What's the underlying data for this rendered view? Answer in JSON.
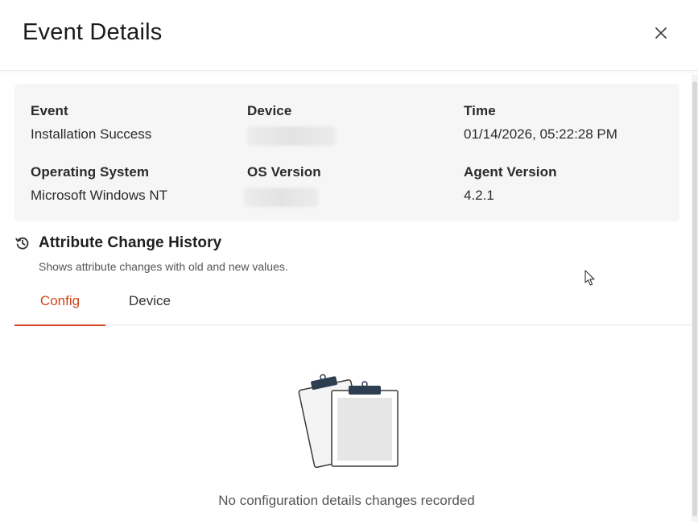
{
  "dialog": {
    "title": "Event Details",
    "close_icon": "close-icon"
  },
  "details": {
    "event": {
      "label": "Event",
      "value": "Installation Success"
    },
    "device": {
      "label": "Device",
      "value_redacted": true
    },
    "time": {
      "label": "Time",
      "value": "01/14/2026, 05:22:28 PM"
    },
    "operating_system": {
      "label": "Operating System",
      "value": "Microsoft Windows NT"
    },
    "os_version": {
      "label": "OS Version",
      "value_redacted": true
    },
    "agent_version": {
      "label": "Agent Version",
      "value": "4.2.1"
    }
  },
  "history": {
    "icon": "history-icon",
    "title": "Attribute Change History",
    "subtitle": "Shows attribute changes with old and new values."
  },
  "tabs": [
    {
      "label": "Config",
      "active": true
    },
    {
      "label": "Device",
      "active": false
    }
  ],
  "empty_state": {
    "icon": "clipboards-illustration",
    "message": "No configuration details changes recorded"
  },
  "colors": {
    "accent": "#d0451b",
    "card_bg": "#f6f6f7",
    "clip_dark": "#2d3e50"
  }
}
